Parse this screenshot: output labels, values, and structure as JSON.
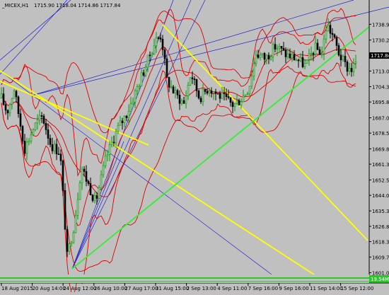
{
  "header": {
    "symbol_timeframe": "_MICEX,H1",
    "ohlc": "1715.90 1718.04 1714.86 1717.84"
  },
  "price_axis": {
    "labels": [
      "1738.95",
      "1730.20",
      "1721.55",
      "1713.00",
      "1704.30",
      "1695.80",
      "1687.05",
      "1678.55",
      "1669.80",
      "1661.30",
      "1652.55",
      "1644.00",
      "1635.35",
      "1626.80",
      "1618.30",
      "1609.75",
      "1601.05"
    ],
    "current_price": "1717.84"
  },
  "time_axis": {
    "labels": [
      "18 Aug 2015",
      "20 Aug 14:00",
      "24 Aug 12:00",
      "26 Aug 10:00",
      "27 Aug 17:00",
      "31 Aug 15:00",
      "2 Sep 13:00",
      "4 Sep 11:00",
      "7 Sep 16:00",
      "9 Sep 16:00",
      "11 Sep 14:00",
      "15 Sep 12:00"
    ]
  },
  "bottom_strip_label": "19.54M",
  "colors": {
    "background": "#c0c0c0",
    "bull_candle": "#00a000",
    "bear_candle": "#000000",
    "bollinger": "#e00000",
    "trend_yellow": "#ffff00",
    "trend_green": "#33ee33",
    "fan_blue": "#2020d0"
  },
  "chart_data": {
    "type": "candlestick",
    "symbol": "_MICEX",
    "timeframe": "H1",
    "ylim": [
      1598.5,
      1743.0
    ],
    "current_price": 1717.84,
    "indicators": [
      "Bollinger Bands (x2)",
      "Trend lines",
      "Fan lines"
    ],
    "price_path": [
      [
        0,
        1700
      ],
      [
        10,
        1690
      ],
      [
        20,
        1703
      ],
      [
        35,
        1670
      ],
      [
        48,
        1682
      ],
      [
        60,
        1688
      ],
      [
        72,
        1672
      ],
      [
        85,
        1668
      ],
      [
        95,
        1610
      ],
      [
        105,
        1628
      ],
      [
        115,
        1660
      ],
      [
        125,
        1650
      ],
      [
        135,
        1640
      ],
      [
        150,
        1665
      ],
      [
        165,
        1680
      ],
      [
        180,
        1690
      ],
      [
        195,
        1705
      ],
      [
        210,
        1720
      ],
      [
        220,
        1730
      ],
      [
        228,
        1733
      ],
      [
        236,
        1708
      ],
      [
        248,
        1700
      ],
      [
        260,
        1695
      ],
      [
        270,
        1712
      ],
      [
        282,
        1698
      ],
      [
        295,
        1704
      ],
      [
        308,
        1700
      ],
      [
        320,
        1697
      ],
      [
        330,
        1694
      ],
      [
        342,
        1698
      ],
      [
        352,
        1704
      ],
      [
        362,
        1723
      ],
      [
        375,
        1720
      ],
      [
        390,
        1727
      ],
      [
        405,
        1722
      ],
      [
        418,
        1720
      ],
      [
        432,
        1716
      ],
      [
        445,
        1726
      ],
      [
        455,
        1723
      ],
      [
        462,
        1739
      ],
      [
        470,
        1733
      ],
      [
        480,
        1722
      ],
      [
        490,
        1715
      ],
      [
        498,
        1714
      ],
      [
        503,
        1717.8
      ]
    ]
  }
}
